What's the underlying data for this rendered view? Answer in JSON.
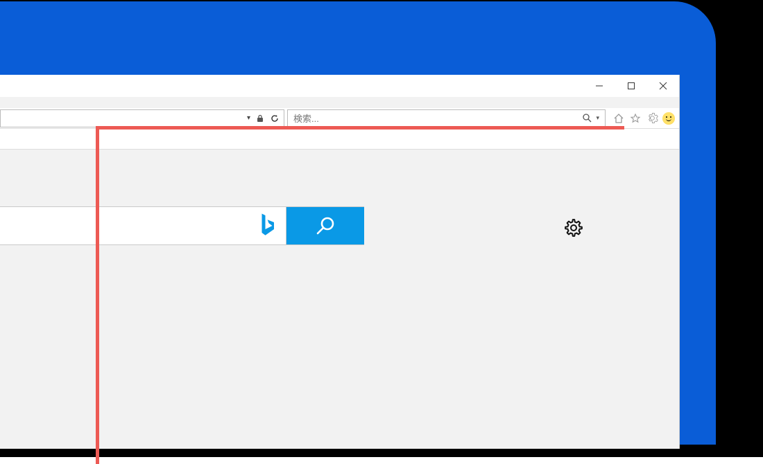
{
  "window": {
    "minimize_label": "Minimize",
    "maximize_label": "Maximize",
    "close_label": "Close"
  },
  "toolbar": {
    "address_placeholder": "",
    "search_placeholder": "検索...",
    "search_dropdown_label": "Search options"
  },
  "top_icons": {
    "home": "home",
    "favorites": "favorites",
    "settings": "settings",
    "feedback": "feedback"
  },
  "content": {
    "bing_name": "Bing",
    "search_input_placeholder": "",
    "search_button_label": "Search",
    "settings_label": "Settings"
  },
  "colors": {
    "accent": "#0a99e6",
    "desktop": "#0a5dd7",
    "annotation": "#ed5a54"
  }
}
